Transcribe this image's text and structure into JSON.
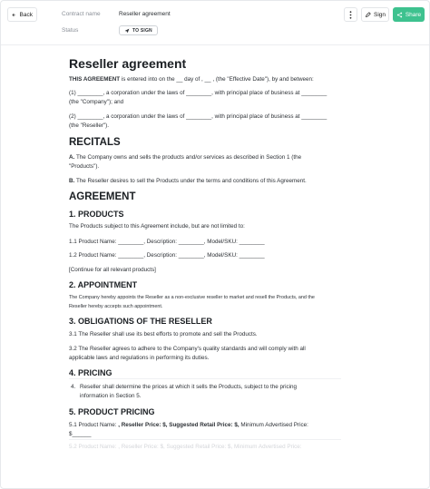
{
  "header": {
    "back_label": "Back",
    "contract_name_label": "Contract name",
    "contract_name_value": "Reseller agreement",
    "status_label": "Status",
    "status_value": "TO SIGN",
    "sign_label": "Sign",
    "share_label": "Share",
    "share_color": "#3ec28f"
  },
  "doc": {
    "title": "Reseller agreement",
    "intro_bold": "THIS AGREEMENT",
    "intro_rest": " is entered into on the __ day of , __ , (the \"Effective Date\"), by and between:",
    "party1_line1": "(1) ________, a corporation under the laws of ________, with principal place of business at ________",
    "party1_line2": "(the \"Company\"); and",
    "party2_line1": "(2) ________, a corporation under the laws of ________, with principal place of business at ________",
    "party2_line2": "(the \"Reseller\").",
    "recitals_heading": "RECITALS",
    "recital_a_bold": "A.",
    "recital_a_line1": " The Company owns and sells the products and/or services as described in Section 1 (the",
    "recital_a_line2": "\"Products\").",
    "recital_b_bold": "B.",
    "recital_b_text": " The Reseller desires to sell the Products under the terms and conditions of this Agreement.",
    "agreement_heading": "AGREEMENT",
    "s1_heading": "1. PRODUCTS",
    "s1_intro": "The Products subject to this Agreement include, but are not limited to:",
    "s1_item1": "1.1 Product Name: ________, Description: ________, Model/SKU: ________",
    "s1_item2": "1.2 Product Name: ________, Description: ________, Model/SKU: ________",
    "s1_more": "[Continue for all relevant products]",
    "s2_heading": "2. APPOINTMENT",
    "s2_line1": "The Company hereby appoints the Reseller as a non-exclusive reseller to market and resell the Products, and the",
    "s2_line2": "Reseller hereby accepts such appointment.",
    "s3_heading": "3. OBLIGATIONS OF THE RESELLER",
    "s3_item1": "3.1 The Reseller shall use its best efforts to promote and sell the Products.",
    "s3_item2_line1": "3.2 The Reseller agrees to adhere to the Company's quality standards and will comply with all",
    "s3_item2_line2": "applicable laws and regulations in performing its duties.",
    "s4_heading": "4. PRICING",
    "s4_num": "4.",
    "s4_line1": "Reseller shall determine the prices at which it sells the Products, subject to the pricing",
    "s4_line2": "information in Section 5.",
    "s5_heading": "5. PRODUCT PRICING",
    "s5_item1_a": "5.1 Product Name: ",
    "s5_item1_b": ", Reseller Price: $, Suggested Retail Price: $,",
    "s5_item1_c": " Minimum Advertised Price:",
    "s5_item1_line2": "$______",
    "s5_item2_faded": "5.2 Product Name: , Reseller Price: $, Suggested Retail Price: $, Minimum Advertised Price:"
  }
}
